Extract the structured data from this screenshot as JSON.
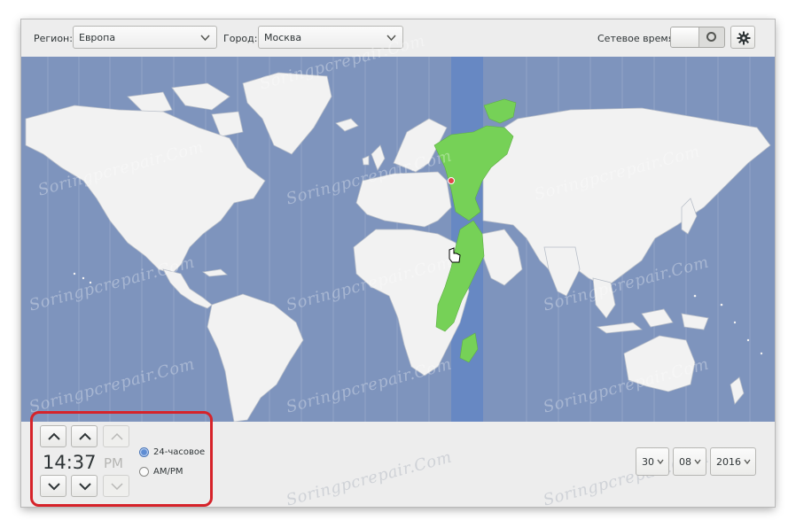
{
  "topbar": {
    "region_label": "Регион:",
    "region_value": "Европа",
    "city_label": "Город:",
    "city_value": "Москва",
    "network_time_label": "Сетевое время",
    "network_time_state": "off",
    "settings_icon": "gear-icon"
  },
  "map": {
    "selected_timezone_color": "#76d157",
    "timezone_band_color": "#6788c3",
    "ocean_color": "#7e94bd",
    "land_color": "#f2f2f2"
  },
  "time": {
    "value": "14:37",
    "ampm": "PM",
    "format_options": [
      {
        "label": "24-часовое",
        "selected": true
      },
      {
        "label": "AM/PM",
        "selected": false
      }
    ]
  },
  "date": {
    "day": "30",
    "month": "08",
    "year": "2016"
  },
  "watermark": "Soringpcrepair.Com",
  "colors": {
    "highlight_border": "#d6232a"
  }
}
